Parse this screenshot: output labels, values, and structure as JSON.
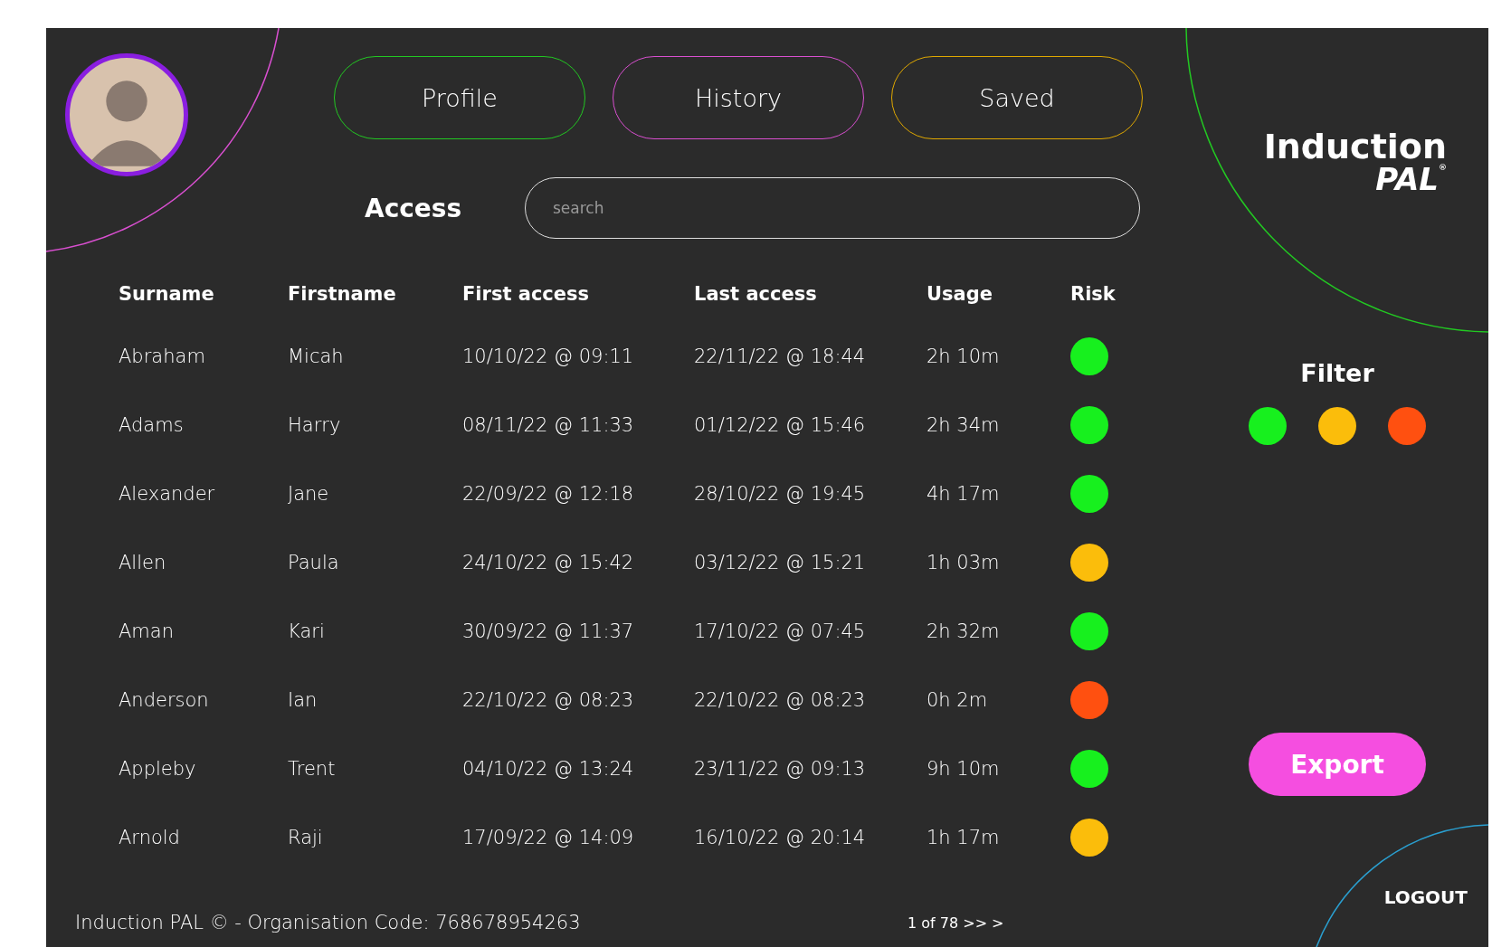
{
  "tabs": [
    {
      "label": "Profile",
      "color": "#22c822"
    },
    {
      "label": "History",
      "color": "#d94fd0"
    },
    {
      "label": "Saved",
      "color": "#e0a800"
    }
  ],
  "section_title": "Access",
  "search": {
    "placeholder": "search"
  },
  "table": {
    "columns": [
      "Surname",
      "Firstname",
      "First access",
      "Last access",
      "Usage",
      "Risk"
    ],
    "rows": [
      {
        "surname": "Abraham",
        "firstname": "Micah",
        "first_access": "10/10/22 @ 09:11",
        "last_access": "22/11/22 @ 18:44",
        "usage": "2h 10m",
        "color": "#17f01e"
      },
      {
        "surname": "Adams",
        "firstname": "Harry",
        "first_access": "08/11/22 @ 11:33",
        "last_access": "01/12/22 @ 15:46",
        "usage": "2h 34m",
        "color": "#17f01e"
      },
      {
        "surname": "Alexander",
        "firstname": "Jane",
        "first_access": "22/09/22 @ 12:18",
        "last_access": "28/10/22 @ 19:45",
        "usage": "4h 17m",
        "color": "#17f01e"
      },
      {
        "surname": "Allen",
        "firstname": "Paula",
        "first_access": "24/10/22 @ 15:42",
        "last_access": "03/12/22 @ 15:21",
        "usage": "1h 03m",
        "color": "#fbbd0b"
      },
      {
        "surname": "Aman",
        "firstname": "Kari",
        "first_access": "30/09/22 @ 11:37",
        "last_access": "17/10/22 @ 07:45",
        "usage": "2h 32m",
        "color": "#17f01e"
      },
      {
        "surname": "Anderson",
        "firstname": "Ian",
        "first_access": "22/10/22 @ 08:23",
        "last_access": "22/10/22 @ 08:23",
        "usage": "0h 2m",
        "color": "#ff5010"
      },
      {
        "surname": "Appleby",
        "firstname": "Trent",
        "first_access": "04/10/22 @ 13:24",
        "last_access": "23/11/22 @ 09:13",
        "usage": "9h 10m",
        "color": "#17f01e"
      },
      {
        "surname": "Arnold",
        "firstname": "Raji",
        "first_access": "17/09/22 @ 14:09",
        "last_access": "16/10/22 @ 20:14",
        "usage": "1h 17m",
        "color": "#fbbd0b"
      }
    ]
  },
  "footer": {
    "copyright": "Induction PAL © - Organisation Code: 768678954263",
    "pagination": "1 of 78 >> >"
  },
  "logo": {
    "line_1": "Induction",
    "line_2": "PAL$^{®}$"
  },
  "filter": {
    "title": "Filter",
    "options": [
      {
        "color": "#17f01e"
      },
      {
        "color": "#fbbd0b"
      },
      {
        "color": "#ff5010"
      }
    ]
  },
  "export_button": "Export",
  "logout": "LOGOUT"
}
